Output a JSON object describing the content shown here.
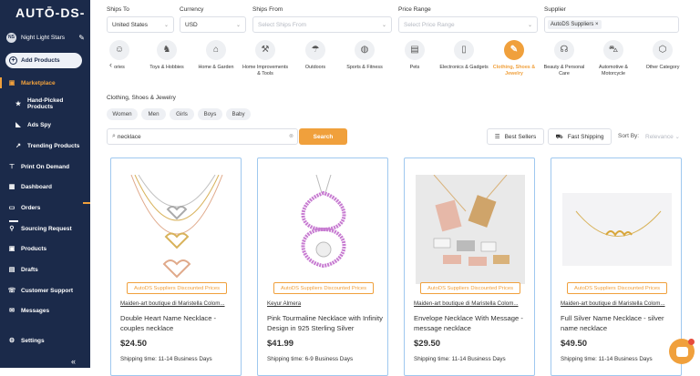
{
  "sidebar": {
    "logo": "AUTŌ-DS-",
    "store": {
      "initials": "NS",
      "name": "Night Light Stars"
    },
    "add_products": "Add Products",
    "items": [
      {
        "label": "Marketplace",
        "icon": "bag-icon"
      },
      {
        "label": "Hand-Picked Products",
        "icon": "star-icon"
      },
      {
        "label": "Ads Spy",
        "icon": "megaphone-icon"
      },
      {
        "label": "Trending Products",
        "icon": "trend-icon"
      },
      {
        "label": "Print On Demand",
        "icon": "shirt-icon"
      },
      {
        "label": "Dashboard",
        "icon": "dashboard-icon"
      },
      {
        "label": "Orders",
        "icon": "orders-icon"
      },
      {
        "label": "Sourcing Request",
        "icon": "sourcing-icon"
      },
      {
        "label": "Products",
        "icon": "box-icon"
      },
      {
        "label": "Drafts",
        "icon": "drafts-icon"
      },
      {
        "label": "Customer Support",
        "icon": "support-icon"
      },
      {
        "label": "Messages",
        "icon": "mail-icon"
      },
      {
        "label": "Settings",
        "icon": "gear-icon"
      }
    ],
    "collapse": "«"
  },
  "filters": {
    "ships_to": {
      "label": "Ships To",
      "value": "United States"
    },
    "currency": {
      "label": "Currency",
      "value": "USD"
    },
    "ships_from": {
      "label": "Ships From",
      "placeholder": "Select Ships From"
    },
    "price_range": {
      "label": "Price Range",
      "placeholder": "Select Price Range"
    },
    "supplier": {
      "label": "Supplier",
      "chip": "AutoDS Suppliers"
    }
  },
  "categories": [
    {
      "label": "ories",
      "icon": "☺"
    },
    {
      "label": "Toys & Hobbies",
      "icon": "♞"
    },
    {
      "label": "Home & Garden",
      "icon": "⌂"
    },
    {
      "label": "Home Improvements & Tools",
      "icon": "⚒"
    },
    {
      "label": "Outdoors",
      "icon": "☂"
    },
    {
      "label": "Sports & Fitness",
      "icon": "◍"
    },
    {
      "label": "Pets",
      "icon": "▤"
    },
    {
      "label": "Electronics & Gadgets",
      "icon": "▯"
    },
    {
      "label": "Clothing, Shoes & Jewelry",
      "icon": "✎"
    },
    {
      "label": "Beauty & Personal Care",
      "icon": "☊"
    },
    {
      "label": "Automotive & Motorcycle",
      "icon": "⛍"
    },
    {
      "label": "Other Category",
      "icon": "⬡"
    }
  ],
  "category_title": "Clothing, Shoes & Jewelry",
  "subcategories": [
    "Women",
    "Men",
    "Girls",
    "Boys",
    "Baby"
  ],
  "search": {
    "value": "necklace",
    "button": "Search"
  },
  "toolbar": {
    "best_sellers": "Best Sellers",
    "fast_shipping": "Fast Shipping",
    "sort_by": "Sort By:",
    "sort_placeholder": "Relevance"
  },
  "products": [
    {
      "badge": "AutoDS Suppliers Discounted Prices",
      "seller": "Maiden-art boutique di Maristella Colom...",
      "title": "Double Heart Name Necklace - couples necklace",
      "price": "$24.50",
      "shipping": "Shipping time: 11-14 Business Days"
    },
    {
      "badge": "AutoDS Suppliers Discounted Prices",
      "seller": "Keyur Almera",
      "title": "Pink Tourmaline Necklace with Infinity Design in 925 Sterling Silver",
      "price": "$41.99",
      "shipping": "Shipping time: 6-9 Business Days"
    },
    {
      "badge": "AutoDS Suppliers Discounted Prices",
      "seller": "Maiden-art boutique di Maristella Colom...",
      "title": "Envelope Necklace With Message - message necklace",
      "price": "$29.50",
      "shipping": "Shipping time: 11-14 Business Days"
    },
    {
      "badge": "AutoDS Suppliers Discounted Prices",
      "seller": "Maiden-art boutique di Maristella Colom...",
      "title": "Full Silver Name Necklace - silver name necklace",
      "price": "$49.50",
      "shipping": "Shipping time: 11-14 Business Days"
    }
  ],
  "colors": {
    "accent": "#f0a03c",
    "sidebar": "#1b2a4a",
    "card_border": "#9fc8ef"
  }
}
